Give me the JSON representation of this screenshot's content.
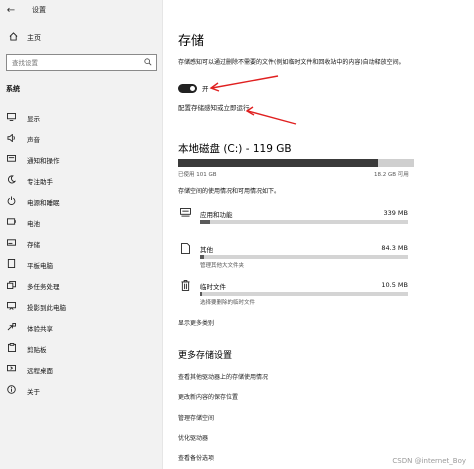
{
  "window": {
    "title": "设置",
    "back_glyph": "←"
  },
  "sidebar": {
    "home_label": "主页",
    "search_placeholder": "查找设置",
    "section_label": "系统",
    "items": [
      {
        "label": "显示",
        "icon": "monitor-icon"
      },
      {
        "label": "声音",
        "icon": "speaker-icon"
      },
      {
        "label": "通知和操作",
        "icon": "notification-icon"
      },
      {
        "label": "专注助手",
        "icon": "moon-icon"
      },
      {
        "label": "电源和睡眠",
        "icon": "power-icon"
      },
      {
        "label": "电池",
        "icon": "battery-icon"
      },
      {
        "label": "存储",
        "icon": "storage-icon"
      },
      {
        "label": "平板电脑",
        "icon": "tablet-icon"
      },
      {
        "label": "多任务处理",
        "icon": "multitask-icon"
      },
      {
        "label": "投影到此电脑",
        "icon": "project-icon"
      },
      {
        "label": "体验共享",
        "icon": "share-icon"
      },
      {
        "label": "剪贴板",
        "icon": "clipboard-icon"
      },
      {
        "label": "远程桌面",
        "icon": "remote-desktop-icon"
      },
      {
        "label": "关于",
        "icon": "info-icon"
      }
    ]
  },
  "main": {
    "title": "存储",
    "description": "存储感知可以通过删除不需要的文件(例如临时文件和回收站中的内容)自动释放空间。",
    "toggle_label": "开",
    "toggle_on": true,
    "config_link": "配置存储感知或立即运行",
    "disk": {
      "title": "本地磁盘 (C:) - 119 GB",
      "used_label": "已使用 101 GB",
      "free_label": "18.2 GB 可用",
      "used_fraction": 0.847
    },
    "storage_desc": "存储空间的使用情况和可用情况如下。",
    "categories": [
      {
        "name": "应用和功能",
        "size": "339 MB",
        "subtitle": "",
        "fill": 0.05,
        "icon": "apps-icon"
      },
      {
        "name": "其他",
        "size": "84.3 MB",
        "subtitle": "管理其他大文件夹",
        "fill": 0.02,
        "icon": "folder-icon"
      },
      {
        "name": "临时文件",
        "size": "10.5 MB",
        "subtitle": "选择要删除的临时文件",
        "fill": 0.01,
        "icon": "trash-icon"
      }
    ],
    "show_more": "显示更多类别",
    "more_settings_title": "更多存储设置",
    "more_links": [
      "查看其他驱动器上的存储使用情况",
      "更改新内容的保存位置",
      "管理存储空间",
      "优化驱动器",
      "查看备份选项"
    ]
  },
  "watermark": "CSDN @internet_Boy",
  "colors": {
    "arrow": "#e02020",
    "sidebar_bg": "#f2f2f2",
    "toggle_on": "#222222"
  }
}
